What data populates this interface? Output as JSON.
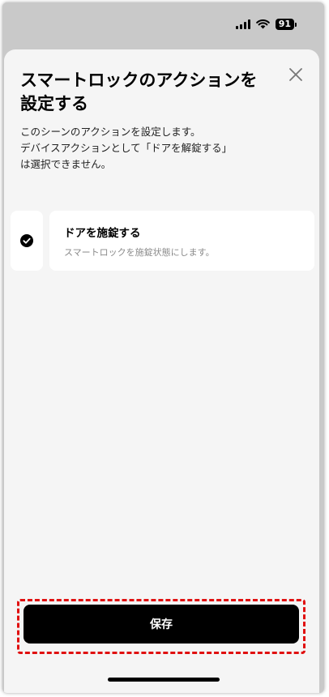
{
  "status_bar": {
    "battery_level": "91",
    "signal_icon": "cellular-signal-icon",
    "wifi_icon": "wifi-icon"
  },
  "sheet": {
    "title": "スマートロックのアクションを\n設定する",
    "description": "このシーンのアクションを設定します。\nデバイスアクションとして「ドアを解錠する」\nは選択できません。",
    "close_icon": "close-icon"
  },
  "actions": [
    {
      "title": "ドアを施錠する",
      "subtitle": "スマートロックを施錠状態にします。",
      "checked": true
    }
  ],
  "footer": {
    "save_label": "保存"
  },
  "colors": {
    "accent": "#000000",
    "highlight": "#e01010",
    "sheet_background": "#f5f5f5"
  }
}
